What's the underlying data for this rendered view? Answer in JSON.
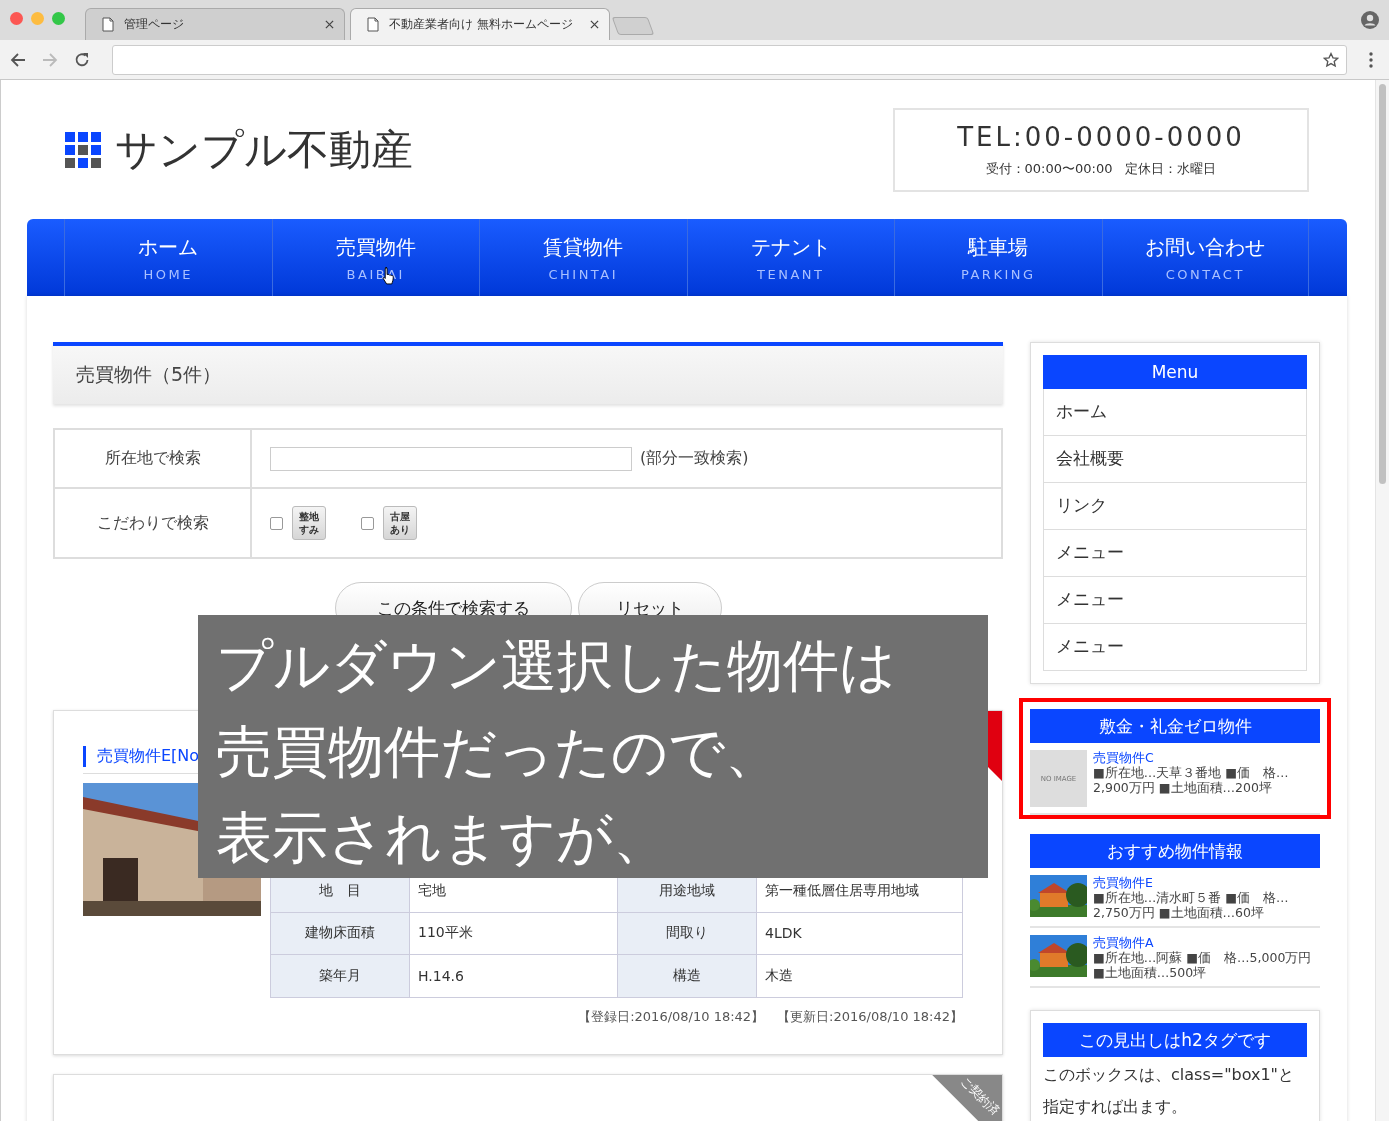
{
  "browser": {
    "tabs": [
      {
        "title": "管理ページ",
        "selected": false
      },
      {
        "title": "不動産業者向け 無料ホームページ",
        "selected": true
      }
    ]
  },
  "header": {
    "logo": "サンプル不動産",
    "tel": "TEL:00-0000-0000",
    "hours": "受付：00:00〜00:00　定休日：水曜日"
  },
  "nav": [
    {
      "label": "ホーム",
      "sub": "HOME"
    },
    {
      "label": "売買物件",
      "sub": "BAIBAI"
    },
    {
      "label": "賃貸物件",
      "sub": "CHINTAI"
    },
    {
      "label": "テナント",
      "sub": "TENANT"
    },
    {
      "label": "駐車場",
      "sub": "PARKING"
    },
    {
      "label": "お問い合わせ",
      "sub": "CONTACT"
    }
  ],
  "main": {
    "heading": "売買物件（5件）",
    "search": [
      {
        "kind": "text",
        "label": "所在地で検索",
        "note": "(部分一致検索)"
      },
      {
        "kind": "checkboxes",
        "label": "こだわりで検索",
        "options": [
          {
            "badge": "整地すみ",
            "checked": false
          },
          {
            "badge": "古屋あり",
            "checked": false
          }
        ]
      }
    ],
    "buttons": [
      "この条件で検索する",
      "リセット"
    ],
    "listings": [
      {
        "title": "売買物件E[No",
        "ribbon": {
          "kind": "recommended"
        },
        "specs": [
          {
            "k1": "地　目",
            "v1": "宅地",
            "k2": "用途地域",
            "v2": "第一種低層住居専用地域"
          },
          {
            "k1": "建物床面積",
            "v1": "110平米",
            "k2": "間取り",
            "v2": "4LDK"
          },
          {
            "k1": "築年月",
            "v1": "H.14.6",
            "k2": "構造",
            "v2": "木造"
          }
        ],
        "dates": "【登録日:2016/08/10 18:42】　【更新日:2016/08/10 18:42】"
      },
      {
        "ribbon": {
          "kind": "contracted",
          "text": "ご契約済"
        }
      }
    ]
  },
  "sidebar": {
    "menu": {
      "title": "Menu",
      "items": [
        "ホーム",
        "会社概要",
        "リンク",
        "メニュー",
        "メニュー",
        "メニュー"
      ]
    },
    "panels": [
      {
        "title": "敷金・礼金ゼロ物件",
        "highlighted": true,
        "items": [
          {
            "name": "売買物件C",
            "details": "■所在地…天草３番地 ■価　格…2,900万円 ■土地面積…200坪",
            "image": {
              "kind": "placeholder",
              "text": "NO IMAGE"
            }
          }
        ]
      },
      {
        "title": "おすすめ物件情報",
        "highlighted": false,
        "items": [
          {
            "name": "売買物件E",
            "details": "■所在地…清水町５番 ■価　格…2,750万円 ■土地面積…60坪"
          },
          {
            "name": "売買物件A",
            "details": "■所在地…阿蘇 ■価　格…5,000万円 ■土地面積…500坪"
          }
        ]
      }
    ],
    "box": {
      "title": "この見出しはh2タグです",
      "text": "このボックスは、class=\"box1\"と指定すれば出ます。"
    }
  },
  "caption": [
    "プルダウン選択した物件は",
    "売買物件だったので、",
    "表示されますが、"
  ]
}
